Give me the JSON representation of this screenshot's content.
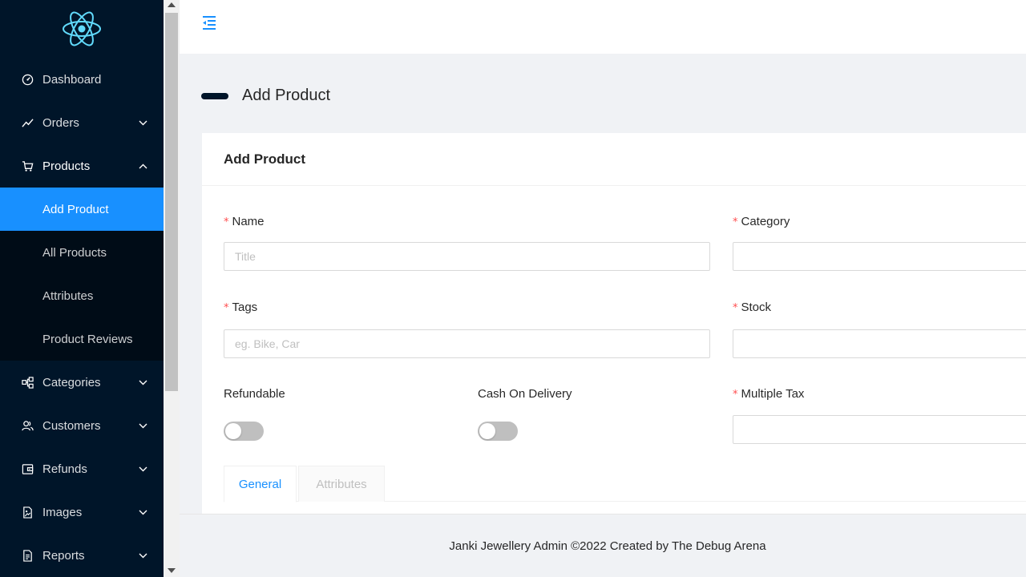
{
  "app": {
    "logo_icon": "react-atom-icon",
    "accent_color": "#1890ff",
    "sidebar_bg": "#001529"
  },
  "sidebar": {
    "items": [
      {
        "label": "Dashboard",
        "icon": "dashboard-icon"
      },
      {
        "label": "Orders",
        "icon": "line-chart-icon",
        "expandable": true
      },
      {
        "label": "Products",
        "icon": "cart-icon",
        "expandable": true,
        "expanded": true,
        "children": [
          {
            "label": "Add Product",
            "active": true
          },
          {
            "label": "All Products"
          },
          {
            "label": "Attributes"
          },
          {
            "label": "Product Reviews"
          }
        ]
      },
      {
        "label": "Categories",
        "icon": "cluster-icon",
        "expandable": true
      },
      {
        "label": "Customers",
        "icon": "users-icon",
        "expandable": true
      },
      {
        "label": "Refunds",
        "icon": "wallet-icon",
        "expandable": true
      },
      {
        "label": "Images",
        "icon": "file-image-icon",
        "expandable": true
      },
      {
        "label": "Reports",
        "icon": "file-text-icon",
        "expandable": true
      }
    ]
  },
  "header": {
    "collapse_icon": "menu-fold-icon"
  },
  "page": {
    "title": "Add Product"
  },
  "card": {
    "title": "Add Product",
    "fields": {
      "name": {
        "label": "Name",
        "required": "*",
        "placeholder": "Title",
        "value": ""
      },
      "category": {
        "label": "Category",
        "required": "*",
        "value": ""
      },
      "tags": {
        "label": "Tags",
        "required": "*",
        "placeholder": "eg. Bike, Car",
        "value": ""
      },
      "stock": {
        "label": "Stock",
        "required": "*",
        "value": ""
      },
      "refundable": {
        "label": "Refundable",
        "checked": false
      },
      "cod": {
        "label": "Cash On Delivery",
        "checked": false
      },
      "multiple_tax": {
        "label": "Multiple Tax",
        "required": "*",
        "value": ""
      }
    },
    "tabs": [
      {
        "label": "General",
        "active": true
      },
      {
        "label": "Attributes",
        "active": false
      }
    ]
  },
  "footer": {
    "text": "Janki Jewellery Admin ©2022 Created by The Debug Arena"
  }
}
